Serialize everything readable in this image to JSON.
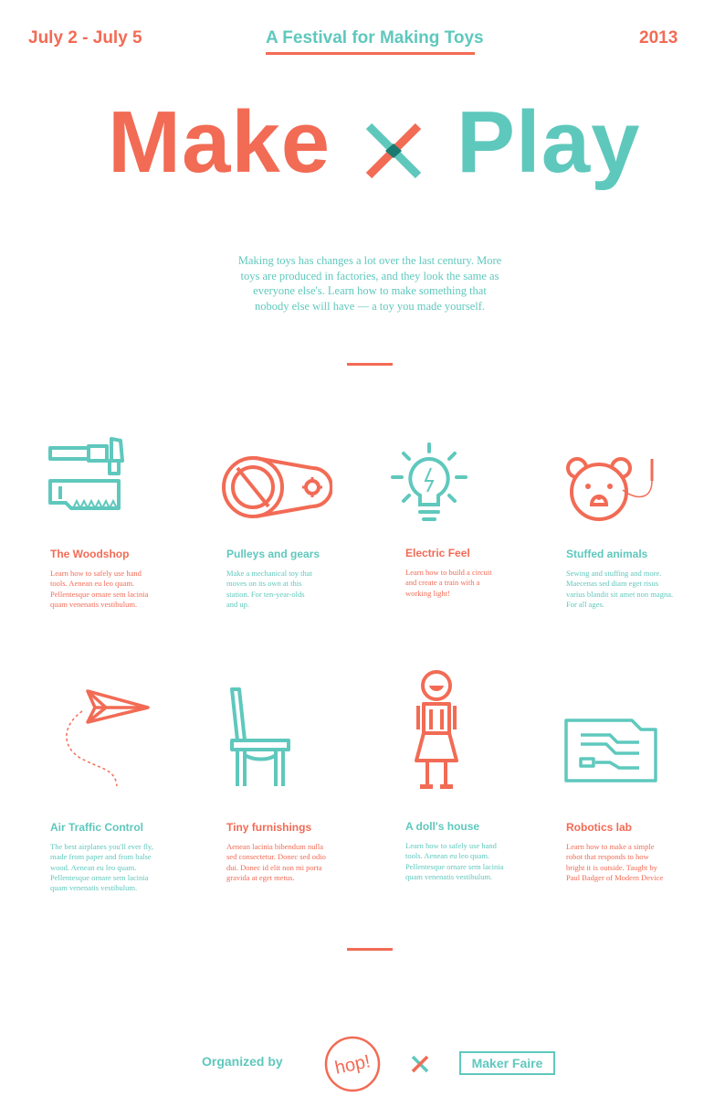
{
  "header": {
    "dates": "July 2 - July 5",
    "tagline": "A Festival for Making Toys",
    "year": "2013"
  },
  "title": {
    "make": "Make",
    "play": "Play"
  },
  "intro": "Making toys has changes a lot over the last century. More toys are produced in factories, and they look the same as everyone else's. Learn how to make something that nobody else will have — a toy you made yourself.",
  "colors": {
    "coral": "#f26b55",
    "teal": "#5fc8bd",
    "dark_teal": "#1a7a70"
  },
  "stations": [
    {
      "icon": "hammer-saw-icon",
      "title": "The Woodshop",
      "desc": "Learn how to safely use hand tools. Aenean eu leo quam. Pellentesque ornare sem lacinia quam venenatis vestibulum."
    },
    {
      "icon": "pulley-gear-icon",
      "title": "Pulleys and gears",
      "desc": "Make a mechanical toy that moves on its own at this station. For ten-year-olds and up."
    },
    {
      "icon": "lightbulb-icon",
      "title": "Electric Feel",
      "desc": "Learn how to build a circuit and create a train with a working light!"
    },
    {
      "icon": "teddy-bear-icon",
      "title": "Stuffed animals",
      "desc": "Sewing and stuffing and more. Maecenas sed diam eget risus varius blandit sit amet non magna. For all ages."
    },
    {
      "icon": "paper-airplane-icon",
      "title": "Air Traffic Control",
      "desc": "The best airplanes you'll ever fly, made from paper and from balse wood. Aenean eu leo quam. Pellentesque ornare sem lacinia quam venenatis vestibulum."
    },
    {
      "icon": "chair-icon",
      "title": "Tiny furnishings",
      "desc": "Aenean lacinia bibendum nulla sed consectetur. Donec sed odio dui. Donec id elit non mi porta gravida at eget metus."
    },
    {
      "icon": "doll-icon",
      "title": "A doll's house",
      "desc": "Learn how to safely use hand tools. Aenean eu leo quam. Pellentesque ornare sem lacinia quam venenatis vestibulum."
    },
    {
      "icon": "circuit-board-icon",
      "title": "Robotics lab",
      "desc": "Learn how to make a simple robot that responds to how bright it is outside. Taught by Paul Badger of Modern Device"
    }
  ],
  "footer": {
    "organized_by": "Organized by",
    "hop_logo_text": "hop!",
    "maker_faire": "Maker Faire"
  }
}
